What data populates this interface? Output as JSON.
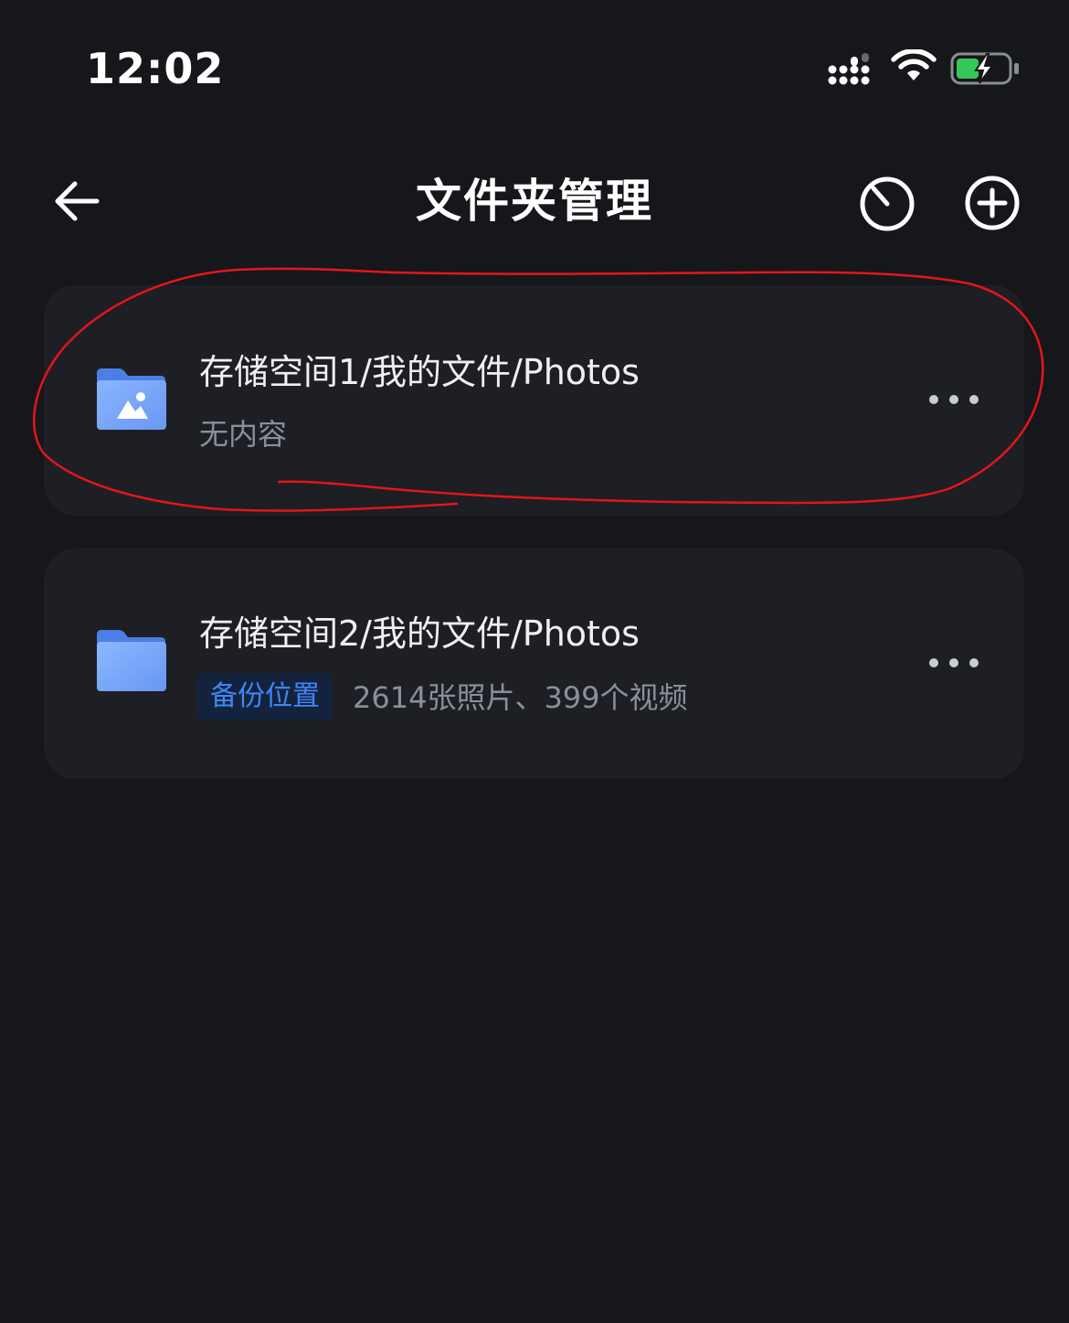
{
  "status_bar": {
    "time": "12:02",
    "signal_icon": "cellular-signal-icon",
    "wifi_icon": "wifi-icon",
    "battery_icon": "battery-charging-icon",
    "battery_color": "#34c759"
  },
  "header": {
    "title": "文件夹管理",
    "back_icon": "arrow-left-icon",
    "timer_icon": "timer-icon",
    "add_icon": "plus-circle-icon"
  },
  "folders": [
    {
      "path": "存储空间1/我的文件/Photos",
      "subtitle": "无内容",
      "icon": "photo-folder-icon",
      "more_icon": "more-horizontal-icon"
    },
    {
      "path": "存储空间2/我的文件/Photos",
      "badge": "备份位置",
      "subtitle": "2614张照片、399个视频",
      "icon": "folder-icon",
      "more_icon": "more-horizontal-icon"
    }
  ],
  "colors": {
    "background": "#15171b",
    "card": "#1d1f24",
    "accent": "#3f86f5",
    "annotation": "#e5141b"
  }
}
